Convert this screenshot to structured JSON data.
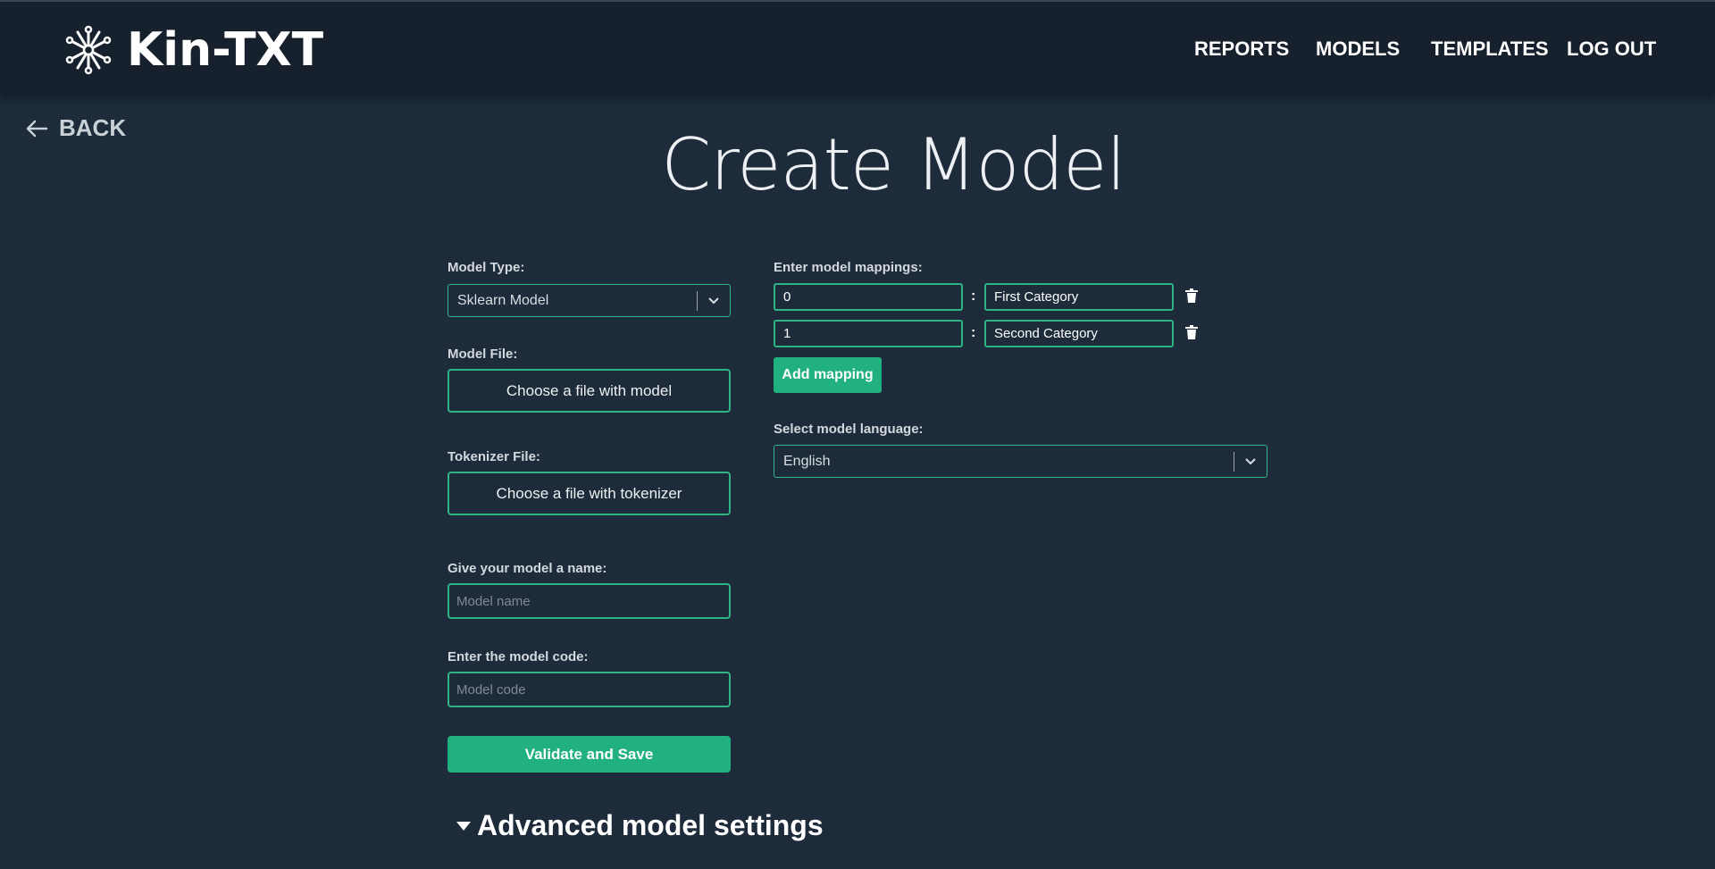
{
  "app": {
    "name": "Kin-TXT"
  },
  "nav": {
    "reports": "REPORTS",
    "models": "MODELS",
    "templates": "TEMPLATES",
    "logout": "LOG OUT"
  },
  "back": {
    "label": "BACK"
  },
  "page": {
    "title": "Create Model"
  },
  "form": {
    "model_type": {
      "label": "Model Type:",
      "value": "Sklearn Model"
    },
    "model_file": {
      "label": "Model File:",
      "button": "Choose a file with model"
    },
    "tokenizer_file": {
      "label": "Tokenizer File:",
      "button": "Choose a file with tokenizer"
    },
    "model_name": {
      "label": "Give your model a name:",
      "placeholder": "Model name"
    },
    "model_code": {
      "label": "Enter the model code:",
      "placeholder": "Model code"
    },
    "save_button": "Validate and Save",
    "advanced": "Advanced model settings"
  },
  "mappings": {
    "label": "Enter model mappings:",
    "separator": ":",
    "rows": [
      {
        "key": "0",
        "value": "First Category"
      },
      {
        "key": "1",
        "value": "Second Category"
      }
    ],
    "add_button": "Add mapping"
  },
  "language": {
    "label": "Select model language:",
    "value": "English"
  },
  "colors": {
    "accent": "#21b07f",
    "border": "#2fb585",
    "background": "#1d2b3a",
    "header": "#16212d"
  },
  "icons": {
    "logo": "network-logo-icon",
    "back": "arrow-left-icon",
    "chevron": "chevron-down-icon",
    "delete": "trash-icon",
    "disclosure": "triangle-down-icon"
  }
}
